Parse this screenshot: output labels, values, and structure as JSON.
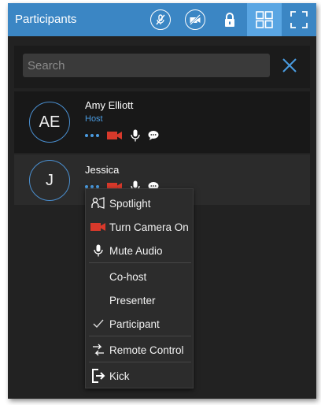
{
  "header": {
    "title": "Participants",
    "buttons": [
      {
        "name": "mute-all",
        "icon": "mic-off-icon"
      },
      {
        "name": "video-off",
        "icon": "video-off-icon"
      },
      {
        "name": "lock",
        "icon": "lock-icon"
      },
      {
        "name": "grid-view",
        "icon": "grid-icon",
        "active": true
      },
      {
        "name": "fullscreen",
        "icon": "fullscreen-icon"
      }
    ]
  },
  "search": {
    "placeholder": "Search"
  },
  "participants": [
    {
      "initials": "AE",
      "name": "Amy Elliott",
      "role": "Host"
    },
    {
      "initials": "J",
      "name": "Jessica",
      "role": ""
    }
  ],
  "context_menu": {
    "items": [
      {
        "label": "Spotlight",
        "icon": "spotlight-icon"
      },
      {
        "label": "Turn Camera On",
        "icon": "camera-icon"
      },
      {
        "label": "Mute Audio",
        "icon": "mic-icon"
      },
      {
        "label": "Co-host",
        "icon": ""
      },
      {
        "label": "Presenter",
        "icon": ""
      },
      {
        "label": "Participant",
        "icon": "checkmark-icon",
        "checked": true
      },
      {
        "label": "Remote Control",
        "icon": "remote-control-icon"
      },
      {
        "label": "Kick",
        "icon": "kick-icon"
      }
    ]
  },
  "colors": {
    "titlebar": "#3b86c4",
    "active_button": "#5aa6e3",
    "accent": "#4a9be0",
    "camera_red": "#d8392b",
    "panel": "#222222"
  }
}
